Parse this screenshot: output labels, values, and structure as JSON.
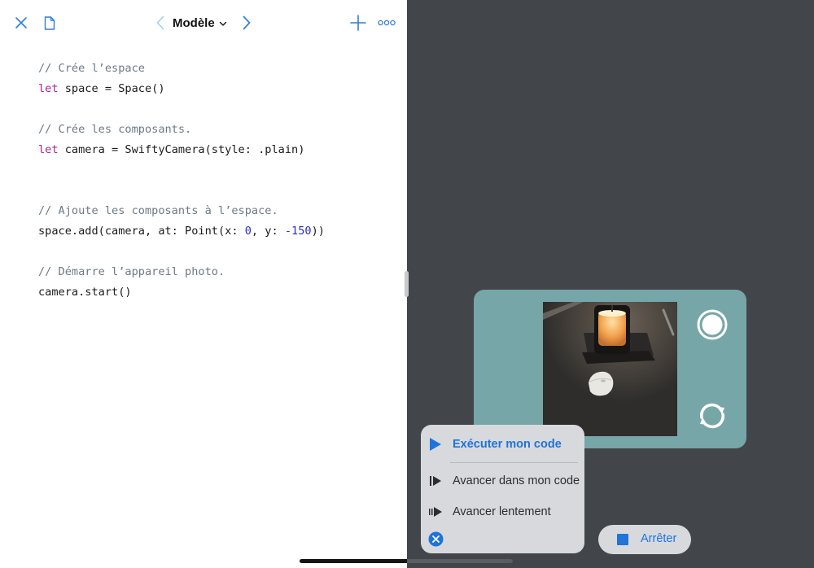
{
  "toolbar": {
    "title": "Modèle",
    "icons": [
      "close-icon",
      "document-icon",
      "chevron-left-icon",
      "chevron-down-icon",
      "chevron-right-icon",
      "plus-icon",
      "more-icon"
    ]
  },
  "code": {
    "line1": "// Crée l’espace",
    "line2_kw": "let",
    "line2_rest": " space = Space()",
    "line4": "// Crée les composants.",
    "line5_kw": "let",
    "line5_rest": " camera = SwiftyCamera(style: .plain)",
    "line8": "// Ajoute les composants à l’espace.",
    "line9_a": "space.add(camera, at: Point(x: ",
    "line9_x": "0",
    "line9_b": ", y: ",
    "line9_y": "-150",
    "line9_c": "))",
    "line11": "// Démarre l’appareil photo.",
    "line12": "camera.start()"
  },
  "camera": {
    "icons": [
      "record-icon",
      "switch-camera-icon"
    ]
  },
  "run_menu": {
    "run": "Exécuter mon code",
    "step": "Avancer dans mon code",
    "slow": "Avancer lentement"
  },
  "stop": {
    "label": "Arrêter"
  },
  "colors": {
    "accent": "#2f7fd8",
    "live_background": "#424549",
    "camera_card": "#76a6a8",
    "menu_background": "#d8d9dd",
    "keyword": "#a3249a",
    "comment": "#6c7a86",
    "number": "#2a2bd0"
  }
}
